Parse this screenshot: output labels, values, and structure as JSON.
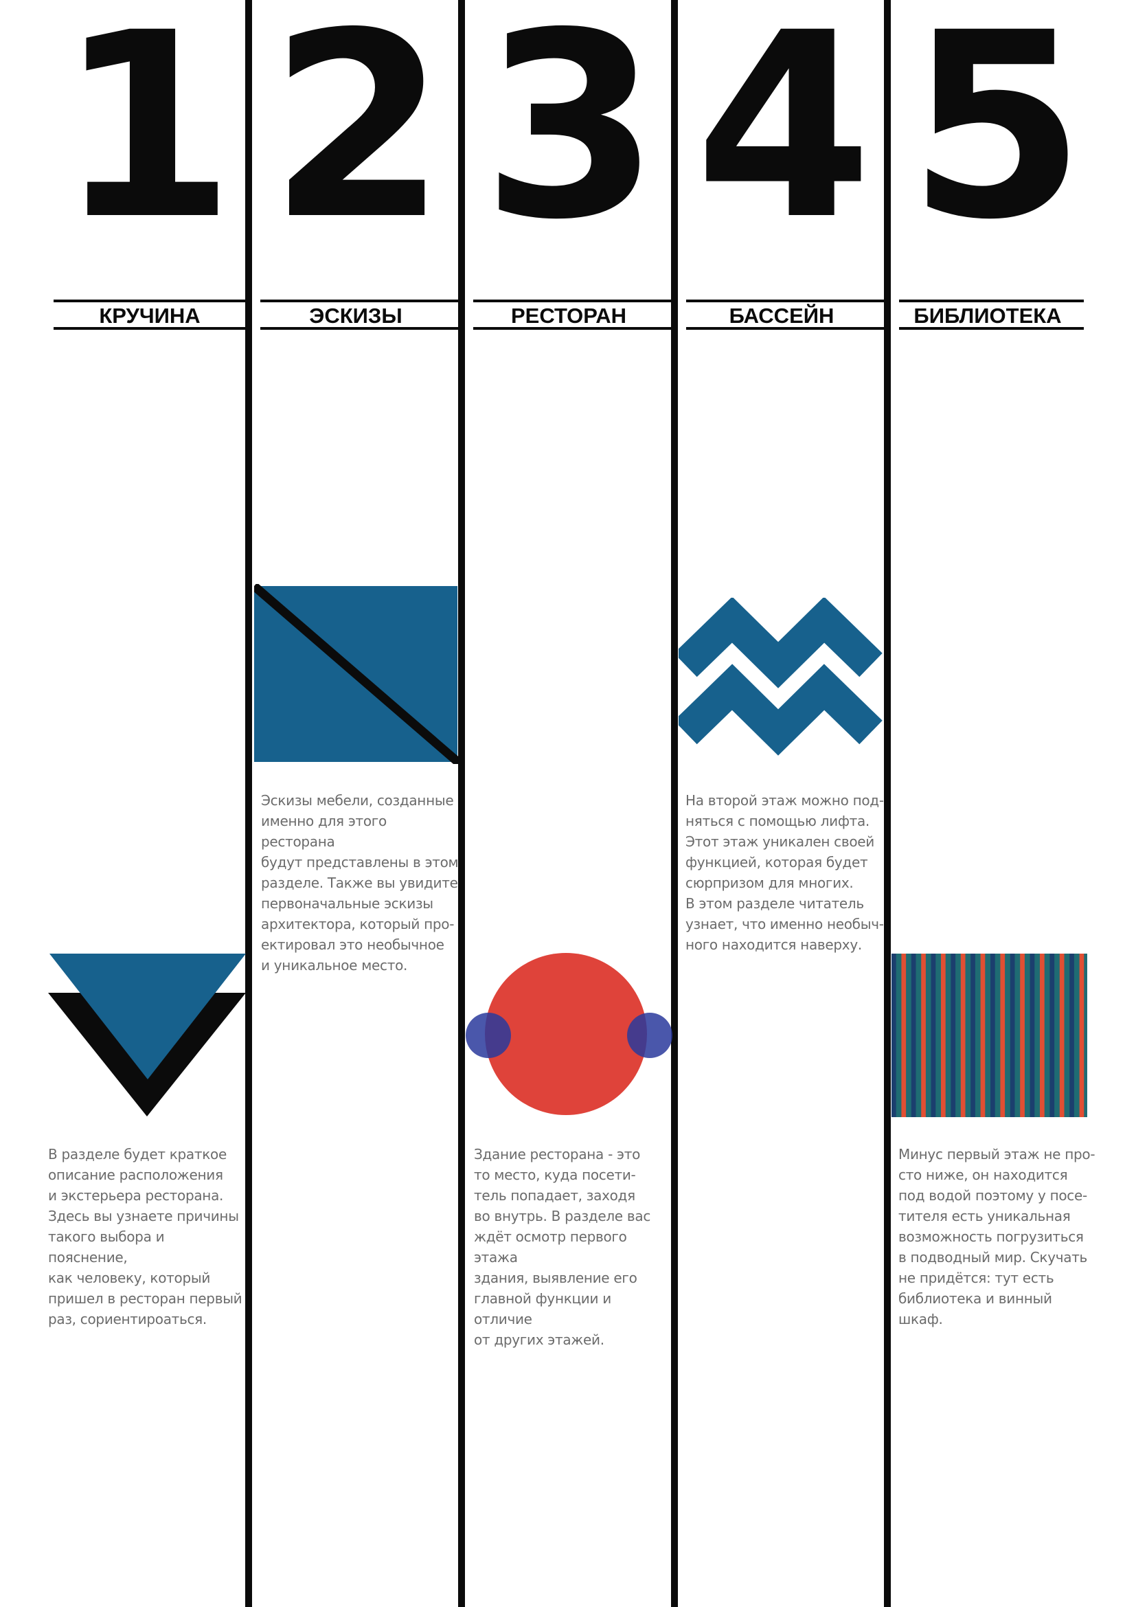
{
  "sections": [
    {
      "number": "1",
      "title": "КРУЧИНА",
      "description": "В разделе будет краткое\nописание расположения\nи экстерьера ресторана.\nЗдесь вы узнаете причины\nтакого выбора и пояснение,\nкак человеку, который\nпришел в ресторан первый\nраз, сориентироаться.",
      "icon": "triangle-icon"
    },
    {
      "number": "2",
      "title": "ЭСКИЗЫ",
      "description": "Эскизы мебели, созданные\nименно для этого ресторана\nбудут представлены в этом\nразделе. Также вы увидите\nпервоначальные эскизы\nархитектора, который про-\nектировал это необычное\nи уникальное место.",
      "icon": "split-square-icon"
    },
    {
      "number": "3",
      "title": "РЕСТОРАН",
      "description": "Здание ресторана - это\nто место, куда посети-\nтель попадает, заходя\nво внутрь. В разделе вас\nждёт осмотр первого этажа\nздания, выявление его\nглавной функции и отличие\nот других этажей.",
      "icon": "circle-icon"
    },
    {
      "number": "4",
      "title": "БАССЕЙН",
      "description": "На второй этаж можно под-\nняться с помощью лифта.\nЭтот этаж уникален своей\nфункцией, которая будет\nсюрпризом для многих.\nВ этом разделе читатель\nузнает, что именно необыч-\nного находится наверху.",
      "icon": "zigzag-waves-icon"
    },
    {
      "number": "5",
      "title": "БИБЛИОТЕКА",
      "description": "Минус первый этаж не про-\nсто ниже, он находится\nпод водой поэтому у посе-\nтителя есть уникальная\nвозможность погрузиться\nв подводный мир. Скучать\nне придётся: тут есть\nбиблиотека и винный шкаф.",
      "icon": "stripes-icon"
    }
  ],
  "colors": {
    "blue": "#17618d",
    "red": "#df433a",
    "navy": "#2a3a9c",
    "dark": "#0b0b0b",
    "stripe_teal": "#1f6c73",
    "stripe_navy": "#1b3f6e",
    "stripe_orange": "#e04f33"
  }
}
